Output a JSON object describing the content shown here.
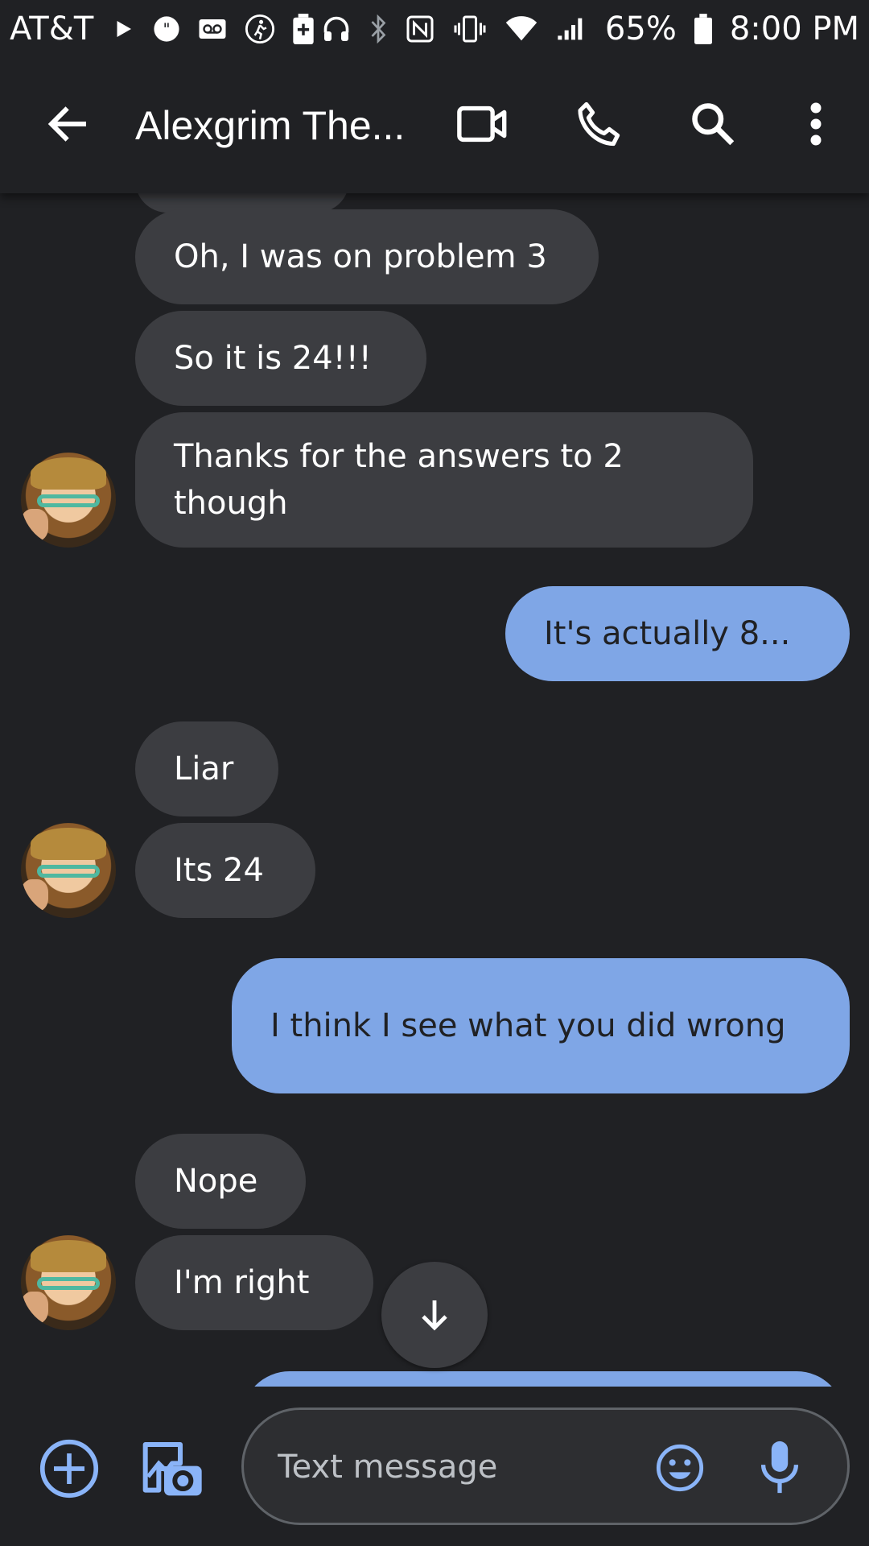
{
  "status_bar": {
    "carrier": "AT&T",
    "battery_percent": "65%",
    "time": "8:00 PM",
    "icons": [
      "play-icon",
      "quote-icon",
      "voicemail-icon",
      "walk-icon",
      "battery-saver-icon",
      "headset-icon",
      "bluetooth-icon",
      "nfc-icon",
      "vibrate-icon",
      "wifi-icon",
      "signal-icon",
      "battery-icon"
    ]
  },
  "header": {
    "title": "Alexgrim The...",
    "actions": [
      "video-call",
      "phone-call",
      "search",
      "more-options"
    ]
  },
  "messages": [
    {
      "text": "Oh, I was on problem 3",
      "direction": "incoming"
    },
    {
      "text": "So it is 24!!!",
      "direction": "incoming"
    },
    {
      "text": "Thanks for the answers to 2 though",
      "direction": "incoming"
    },
    {
      "text": "It's actually 8...",
      "direction": "outgoing"
    },
    {
      "text": "Liar",
      "direction": "incoming"
    },
    {
      "text": "Its 24",
      "direction": "incoming"
    },
    {
      "text": "I think I see what you did wrong",
      "direction": "outgoing"
    },
    {
      "text": "Nope",
      "direction": "incoming"
    },
    {
      "text": "I'm right",
      "direction": "incoming"
    }
  ],
  "composer": {
    "placeholder": "Text message"
  },
  "colors": {
    "background": "#202124",
    "incoming_bubble": "#3c3d41",
    "outgoing_bubble": "#7fa6e6",
    "accent": "#8ab4f8"
  }
}
